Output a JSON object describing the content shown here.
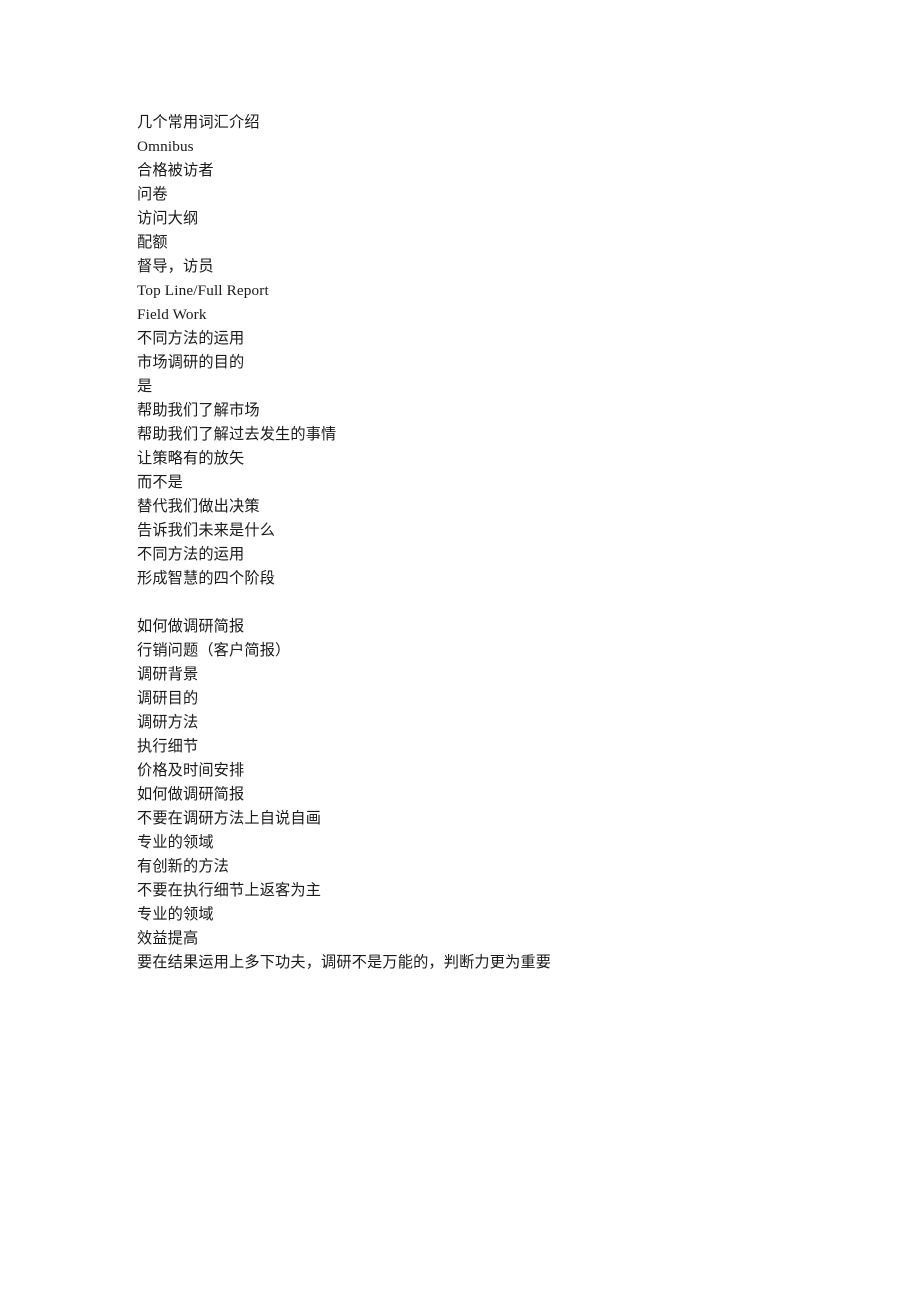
{
  "document": {
    "background_color": "#ffffff",
    "text_color": "#1a1a1a",
    "blocks": [
      {
        "name": "terminology-and-methods-block",
        "lines": [
          "几个常用词汇介绍",
          "Omnibus",
          "合格被访者",
          "问卷",
          "访问大纲",
          "配额",
          "督导，访员",
          "Top Line/Full Report",
          "Field Work",
          "不同方法的运用",
          "市场调研的目的",
          "是",
          "帮助我们了解市场",
          "帮助我们了解过去发生的事情",
          "让策略有的放矢",
          "而不是",
          "替代我们做出决策",
          "告诉我们未来是什么",
          "不同方法的运用",
          "形成智慧的四个阶段"
        ]
      },
      {
        "name": "research-brief-block",
        "lines": [
          "如何做调研简报",
          "行销问题（客户简报）",
          "调研背景",
          "调研目的",
          "调研方法",
          "执行细节",
          "价格及时间安排",
          "如何做调研简报",
          "不要在调研方法上自说自画",
          "专业的领域",
          "有创新的方法",
          "不要在执行细节上返客为主",
          "专业的领域",
          "效益提高",
          "要在结果运用上多下功夫，调研不是万能的，判断力更为重要"
        ]
      }
    ]
  }
}
